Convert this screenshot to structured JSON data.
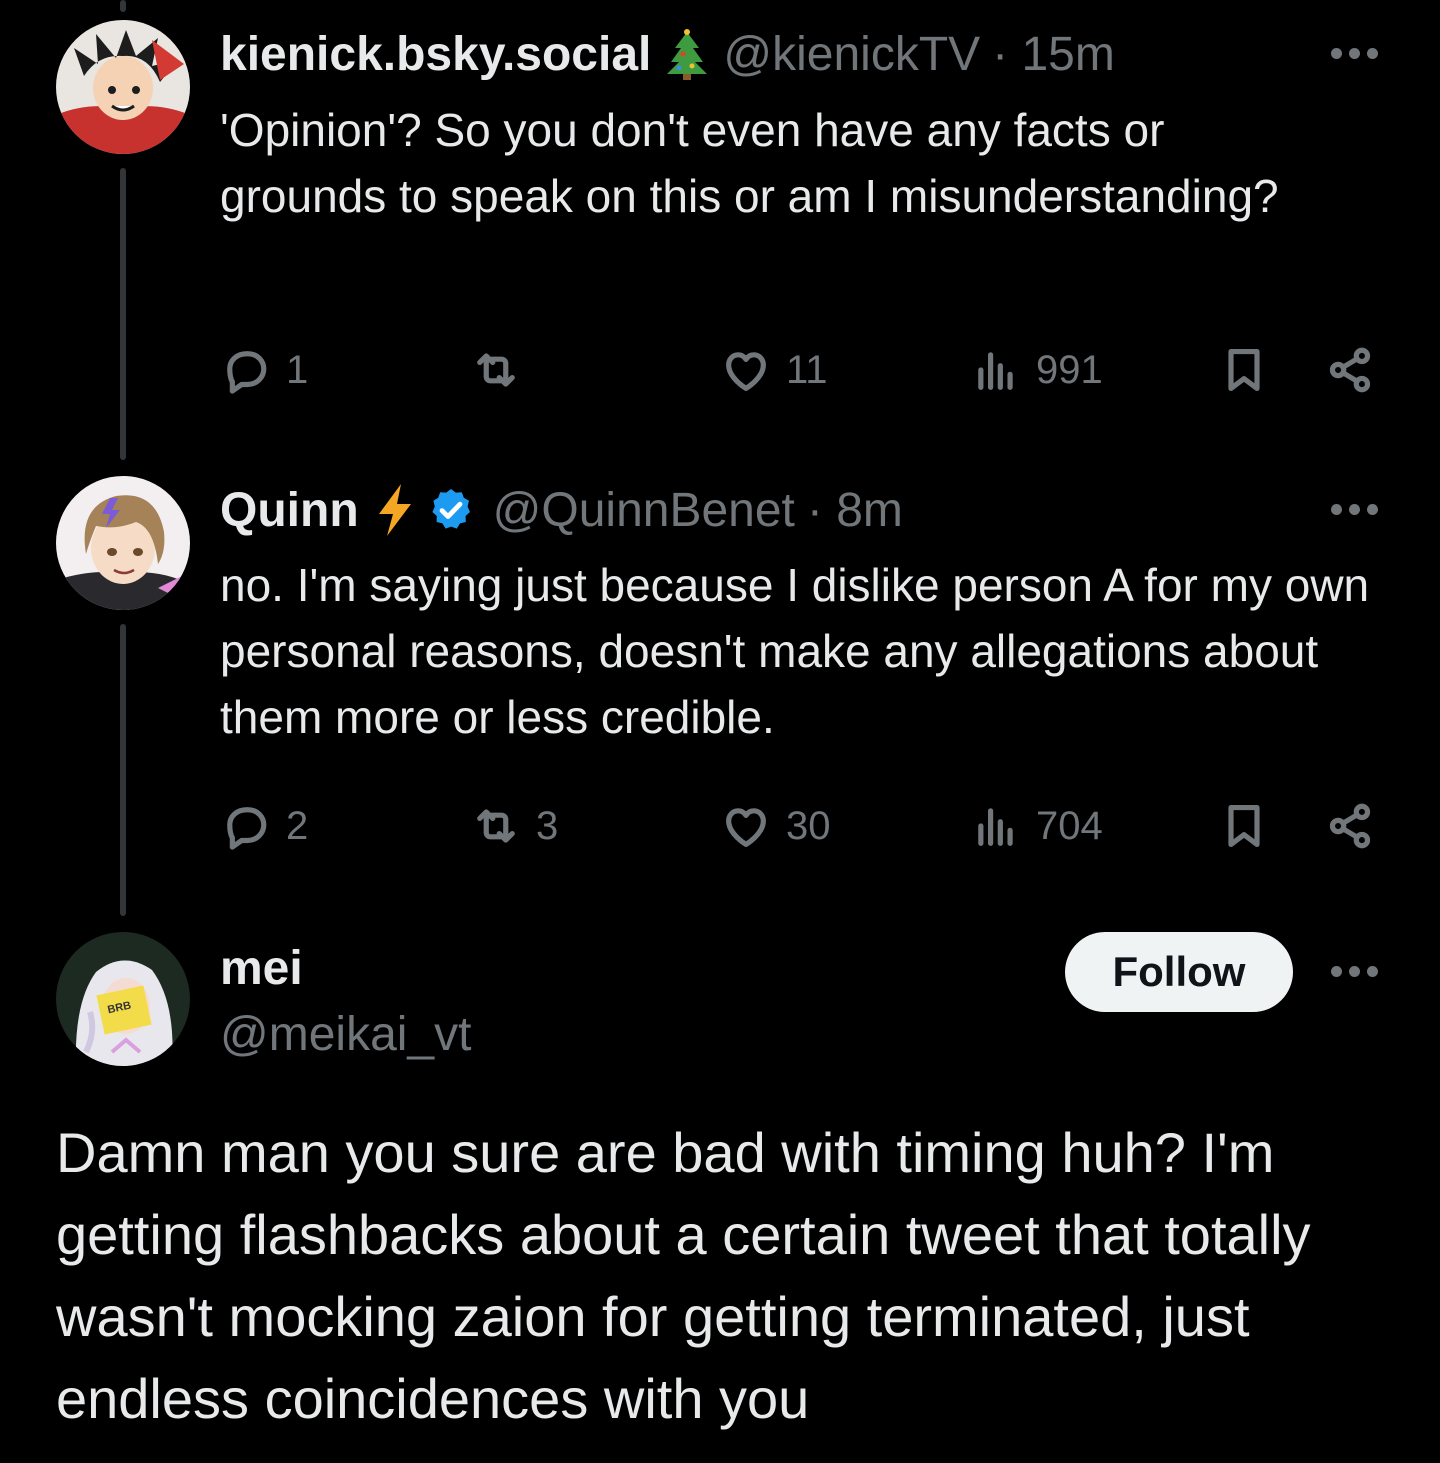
{
  "posts": [
    {
      "display_name": "kienick.bsky.social",
      "emoji": "christmas-tree",
      "handle": "@kienickTV",
      "time": "· 15m",
      "text": "'Opinion'? So you don't even have any facts or grounds to speak on this or am I misunderstanding?",
      "replies": "1",
      "reposts": "",
      "likes": "11",
      "views": "991"
    },
    {
      "display_name": "Quinn",
      "emoji": "lightning",
      "verified": true,
      "handle": "@QuinnBenet",
      "time": "· 8m",
      "text": "no. I'm saying just because I dislike person A for my own personal reasons, doesn't make any allegations about them more or less credible.",
      "replies": "2",
      "reposts": "3",
      "likes": "30",
      "views": "704"
    }
  ],
  "focused": {
    "display_name": "mei",
    "handle": "@meikai_vt",
    "follow_label": "Follow",
    "avatar_sticker": "BRB",
    "text": "Damn man you sure are bad with timing huh? I'm getting flashbacks about a certain tweet that totally wasn't mocking zaion for getting terminated, just endless coincidences with you"
  },
  "colors": {
    "background": "#000000",
    "text": "#e7e9ea",
    "muted": "#71767b",
    "verified": "#1d9bf0",
    "lightning": "#f5a623"
  }
}
